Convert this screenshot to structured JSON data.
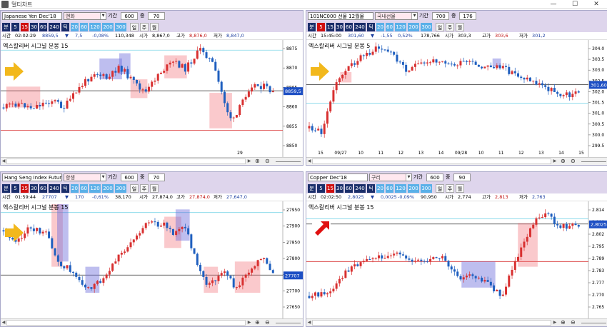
{
  "window": {
    "title": "멀티차트",
    "min": "—",
    "max": "☐",
    "close": "✕"
  },
  "ui": {
    "bun": "분",
    "il": "일",
    "ju": "주",
    "wol": "월",
    "tik": "틱",
    "gigan": "기간",
    "jung": "중",
    "siga": "시가",
    "goga": "고가",
    "jeoga": "저가",
    "sigan": "시간",
    "intervals": [
      "5",
      "15",
      "30",
      "60",
      "240"
    ],
    "longint": [
      "20",
      "60",
      "120",
      "200",
      "300"
    ]
  },
  "panes": [
    {
      "symbol": "Japanese Yen Dec'18",
      "market": "엔화",
      "period": "600",
      "mid": "70",
      "active_interval": 1,
      "info": {
        "time": "02:02:29",
        "price": "8859,5",
        "arrow": "▼",
        "chg": "7,5",
        "pct": "-0,08%",
        "vol": "110,348",
        "siga": "8,867,0",
        "goga": "8,876,0",
        "jeoga": "8,847,0"
      },
      "chart_label": "엑스칼리버 시그널 분봉 15",
      "price_tag": "8859,5",
      "yticks": [
        "8875",
        "8870",
        "8865",
        "8860",
        "8855",
        "8850"
      ],
      "xticks": [
        "29"
      ],
      "arrow_color": "#f2b81c"
    },
    {
      "symbol": "101NC000 선물 12월물",
      "market": "국내선물",
      "period": "700",
      "mid": "176",
      "active_interval": 0,
      "info": {
        "time": "15:45:00",
        "price": "301,60",
        "arrow": "▼",
        "chg": "-1,55",
        "pct": "0,52%",
        "vol": "178,766",
        "siga": "303,3",
        "goga": "303,6",
        "jeoga": "301,2"
      },
      "chart_label": "엑스칼리버 시그널 분봉 5",
      "price_tag": "301,60",
      "yticks": [
        "304.0",
        "303.5",
        "303.0",
        "302.5",
        "302.0",
        "301.5",
        "301.0",
        "300.5",
        "300.0",
        "299.5"
      ],
      "xticks": [
        "15",
        "09/27",
        "10",
        "11",
        "12",
        "13",
        "14",
        "09/28",
        "10",
        "11",
        "12",
        "13",
        "14",
        "15"
      ],
      "arrow_color": "#f2b81c"
    },
    {
      "symbol": "Hang Seng Index Futures",
      "market": "항셍",
      "period": "600",
      "mid": "70",
      "active_interval": 1,
      "info": {
        "time": "01:59:44",
        "price": "27707",
        "arrow": "▼",
        "chg": "170",
        "pct": "-0,61%",
        "vol": "38,170",
        "siga": "27,874,0",
        "goga": "27,874,0",
        "jeoga": "27,647,0"
      },
      "chart_label": "엑스칼리버 시그널 분봉 15",
      "price_tag": "27707",
      "yticks": [
        "27950",
        "27900",
        "27850",
        "27800",
        "27750",
        "27700",
        "27650"
      ],
      "xticks": [],
      "arrow_color": "#f2b81c"
    },
    {
      "symbol": "Copper Dec'18",
      "market": "구리",
      "period": "600",
      "mid": "90",
      "active_interval": 1,
      "info": {
        "time": "02:02:50",
        "price": "2,8025",
        "arrow": "▼",
        "chg": "0,0025",
        "pct": "-0,09%",
        "vol": "90,950",
        "siga": "2,774",
        "goga": "2,813",
        "jeoga": "2,763"
      },
      "chart_label": "엑스칼리버 시그널 분봉 15",
      "price_tag": "2,8025",
      "yticks": [
        "2.814",
        "2.808",
        "2.802",
        "2.795",
        "2.789",
        "2.783",
        "2.777",
        "2.770",
        "2.765"
      ],
      "xticks": [],
      "arrow_color": "#e01010"
    }
  ]
}
